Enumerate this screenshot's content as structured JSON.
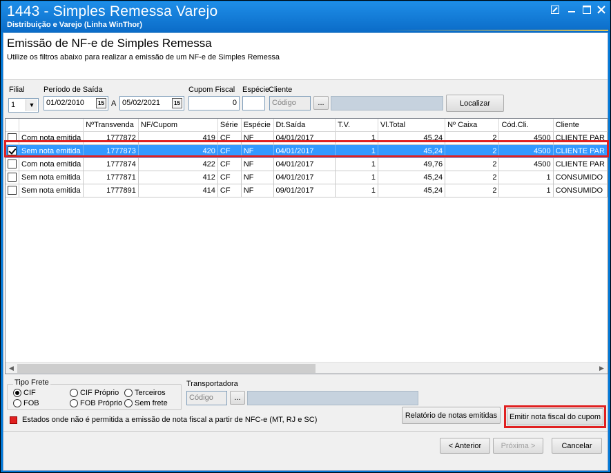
{
  "window": {
    "title": "1443 - Simples Remessa Varejo",
    "subtitle": "Distribuição e Varejo (Linha WinThor)"
  },
  "header": {
    "title": "Emissão de NF-e de Simples Remessa",
    "description": "Utilize os filtros abaixo para realizar a emissão de um NF-e de Simples Remessa"
  },
  "filters": {
    "filial_label": "Filial",
    "filial_value": "1",
    "periodo_label": "Período de Saída",
    "date_from": "01/02/2010",
    "date_sep": "A",
    "date_to": "05/02/2021",
    "cal_icon": "15",
    "cupom_label": "Cupom Fiscal",
    "cupom_value": "0",
    "especie_label": "Espécie",
    "especie_value": "",
    "cliente_label": "Cliente",
    "cliente_placeholder": "Código",
    "ellipsis": "...",
    "localizar": "Localizar"
  },
  "grid": {
    "columns": [
      "",
      "",
      "NºTransvenda",
      "NF/Cupom",
      "Série",
      "Espécie",
      "Dt.Saída",
      "T.V.",
      "Vl.Total",
      "Nº Caixa",
      "Cód.Cli.",
      "Cliente"
    ],
    "rows": [
      {
        "checked": false,
        "status": "Com nota emitida",
        "transvenda": "1777872",
        "nf": "419",
        "serie": "CF",
        "especie": "NF",
        "dt": "04/01/2017",
        "tv": "1",
        "total": "45,24",
        "caixa": "2",
        "codcli": "4500",
        "cliente": "CLIENTE PAR"
      },
      {
        "checked": true,
        "status": "Sem nota emitida",
        "transvenda": "1777873",
        "nf": "420",
        "serie": "CF",
        "especie": "NF",
        "dt": "04/01/2017",
        "tv": "1",
        "total": "45,24",
        "caixa": "2",
        "codcli": "4500",
        "cliente": "CLIENTE PAR"
      },
      {
        "checked": false,
        "status": "Com nota emitida",
        "transvenda": "1777874",
        "nf": "422",
        "serie": "CF",
        "especie": "NF",
        "dt": "04/01/2017",
        "tv": "1",
        "total": "49,76",
        "caixa": "2",
        "codcli": "4500",
        "cliente": "CLIENTE PAR"
      },
      {
        "checked": false,
        "status": "Sem nota emitida",
        "transvenda": "1777871",
        "nf": "412",
        "serie": "CF",
        "especie": "NF",
        "dt": "04/01/2017",
        "tv": "1",
        "total": "45,24",
        "caixa": "2",
        "codcli": "1",
        "cliente": "CONSUMIDO"
      },
      {
        "checked": false,
        "status": "Sem nota emitida",
        "transvenda": "1777891",
        "nf": "414",
        "serie": "CF",
        "especie": "NF",
        "dt": "09/01/2017",
        "tv": "1",
        "total": "45,24",
        "caixa": "2",
        "codcli": "1",
        "cliente": "CONSUMIDO"
      }
    ]
  },
  "frete": {
    "group_label": "Tipo Frete",
    "options": [
      "CIF",
      "CIF Próprio",
      "Terceiros",
      "FOB",
      "FOB Próprio",
      "Sem frete"
    ],
    "selected": "CIF"
  },
  "transportadora": {
    "label": "Transportadora",
    "placeholder": "Código",
    "ellipsis": "..."
  },
  "legend": {
    "text": "Estados onde não é permitida a emissão de nota fiscal a partir de NFC-e (MT, RJ e SC)",
    "color": "#e02020"
  },
  "actions": {
    "relatorio": "Relatório de notas emitidas",
    "emitir": "Emitir nota fiscal do cupom",
    "anterior": "< Anterior",
    "proxima": "Próxima >",
    "cancelar": "Cancelar"
  },
  "colors": {
    "titlebar": "#0b6cc8",
    "selection": "#3399ff",
    "highlight": "#e02020"
  }
}
